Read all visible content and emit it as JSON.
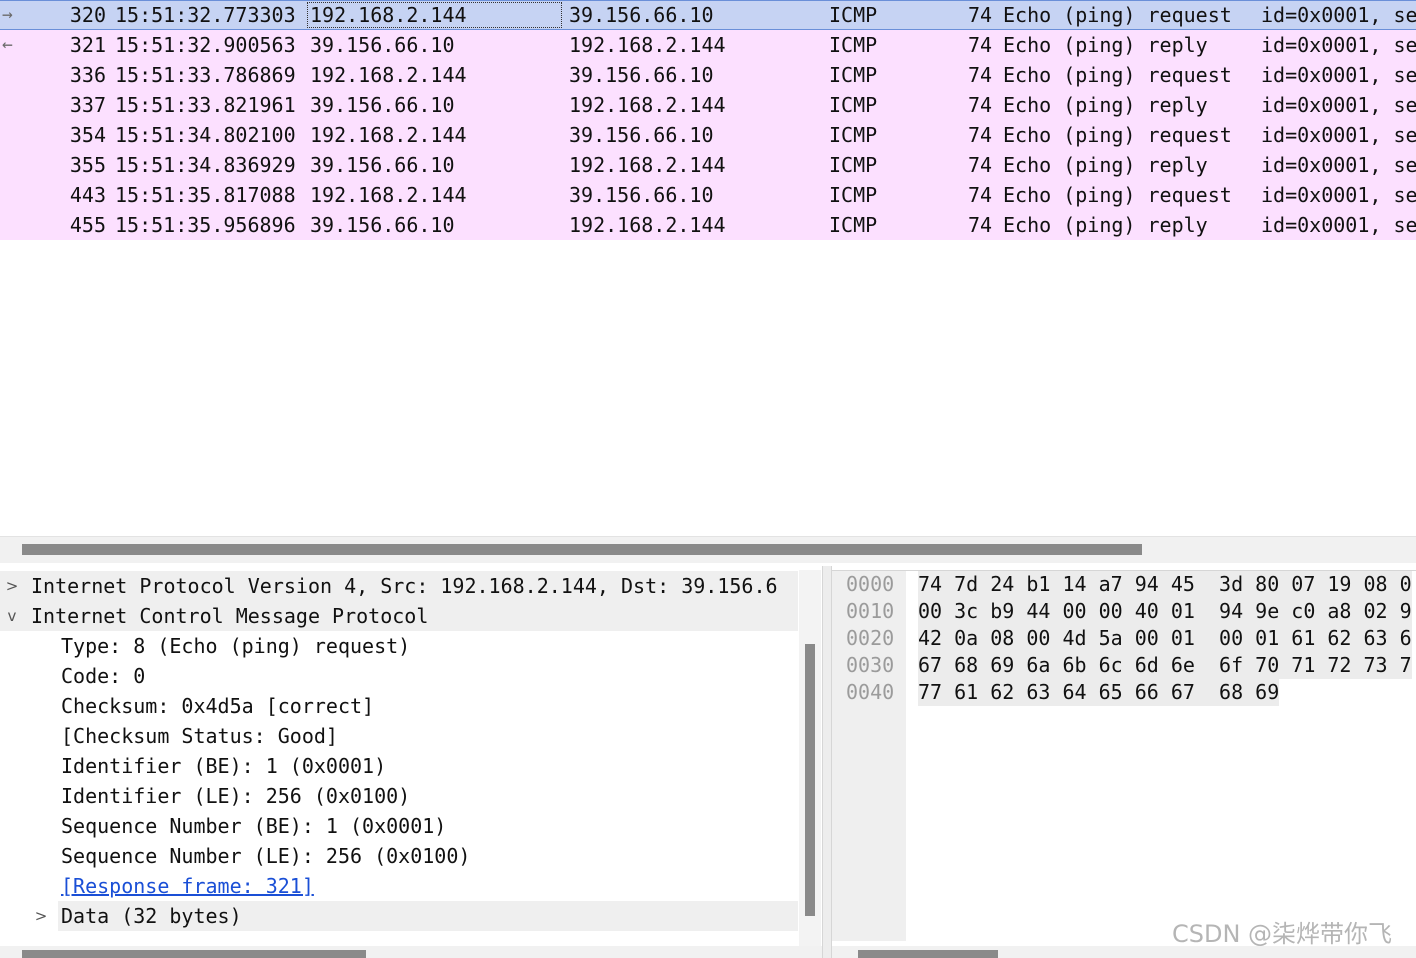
{
  "packets": [
    {
      "no": "320",
      "time": "15:51:32.773303",
      "src": "192.168.2.144",
      "dst": "39.156.66.10",
      "proto": "ICMP",
      "len": "74",
      "info": "Echo (ping) request",
      "id": "id=0x0001, se",
      "dir": "→",
      "selected": true
    },
    {
      "no": "321",
      "time": "15:51:32.900563",
      "src": "39.156.66.10",
      "dst": "192.168.2.144",
      "proto": "ICMP",
      "len": "74",
      "info": "Echo (ping) reply",
      "id": "id=0x0001, se",
      "dir": "←",
      "selected": false
    },
    {
      "no": "336",
      "time": "15:51:33.786869",
      "src": "192.168.2.144",
      "dst": "39.156.66.10",
      "proto": "ICMP",
      "len": "74",
      "info": "Echo (ping) request",
      "id": "id=0x0001, se",
      "dir": "",
      "selected": false
    },
    {
      "no": "337",
      "time": "15:51:33.821961",
      "src": "39.156.66.10",
      "dst": "192.168.2.144",
      "proto": "ICMP",
      "len": "74",
      "info": "Echo (ping) reply",
      "id": "id=0x0001, se",
      "dir": "",
      "selected": false
    },
    {
      "no": "354",
      "time": "15:51:34.802100",
      "src": "192.168.2.144",
      "dst": "39.156.66.10",
      "proto": "ICMP",
      "len": "74",
      "info": "Echo (ping) request",
      "id": "id=0x0001, se",
      "dir": "",
      "selected": false
    },
    {
      "no": "355",
      "time": "15:51:34.836929",
      "src": "39.156.66.10",
      "dst": "192.168.2.144",
      "proto": "ICMP",
      "len": "74",
      "info": "Echo (ping) reply",
      "id": "id=0x0001, se",
      "dir": "",
      "selected": false
    },
    {
      "no": "443",
      "time": "15:51:35.817088",
      "src": "192.168.2.144",
      "dst": "39.156.66.10",
      "proto": "ICMP",
      "len": "74",
      "info": "Echo (ping) request",
      "id": "id=0x0001, se",
      "dir": "",
      "selected": false
    },
    {
      "no": "455",
      "time": "15:51:35.956896",
      "src": "39.156.66.10",
      "dst": "192.168.2.144",
      "proto": "ICMP",
      "len": "74",
      "info": "Echo (ping) reply",
      "id": "id=0x0001, se",
      "dir": "",
      "selected": false
    }
  ],
  "detail": {
    "ipv4": {
      "twisty": ">",
      "text": "Internet Protocol Version 4, Src: 192.168.2.144, Dst: 39.156.6"
    },
    "icmp": {
      "twisty": "v",
      "text": "Internet Control Message Protocol"
    },
    "fields": [
      "Type: 8 (Echo (ping) request)",
      "Code: 0",
      "Checksum: 0x4d5a [correct]",
      "[Checksum Status: Good]",
      "Identifier (BE): 1 (0x0001)",
      "Identifier (LE): 256 (0x0100)",
      "Sequence Number (BE): 1 (0x0001)",
      "Sequence Number (LE): 256 (0x0100)"
    ],
    "response_link": "[Response frame: 321]",
    "data": {
      "twisty": ">",
      "text": "Data (32 bytes)"
    }
  },
  "bytes": [
    {
      "offset": "0000",
      "hex": "74 7d 24 b1 14 a7 94 45  3d 80 07 19 08 0"
    },
    {
      "offset": "0010",
      "hex": "00 3c b9 44 00 00 40 01  94 9e c0 a8 02 9"
    },
    {
      "offset": "0020",
      "hex": "42 0a 08 00 4d 5a 00 01  00 01 61 62 63 6"
    },
    {
      "offset": "0030",
      "hex": "67 68 69 6a 6b 6c 6d 6e  6f 70 71 72 73 7"
    },
    {
      "offset": "0040",
      "hex": "77 61 62 63 64 65 66 67  68 69"
    }
  ],
  "watermark": "CSDN @柒烨带你飞",
  "colors": {
    "icmp_row": "#fce0ff",
    "selected_row": "#c6d3f3",
    "link": "#1a4fd6"
  }
}
